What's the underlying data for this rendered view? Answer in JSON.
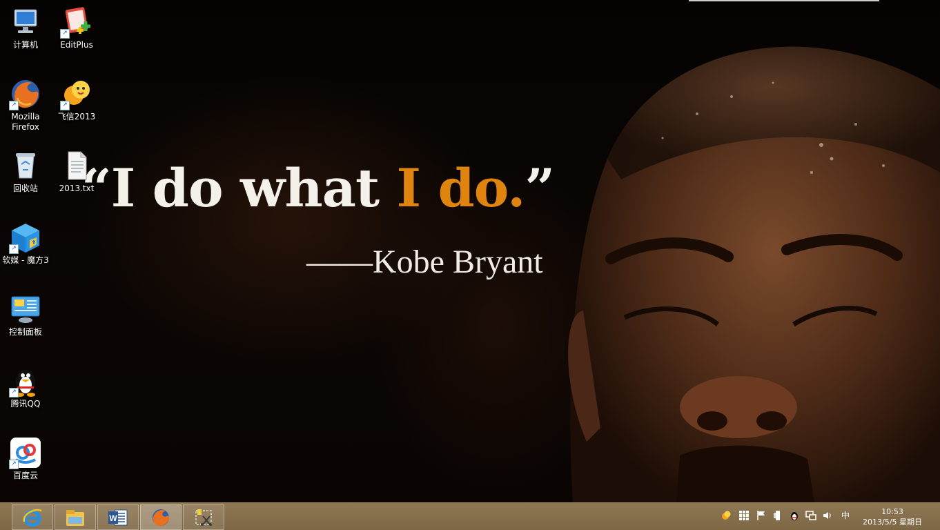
{
  "wallpaper": {
    "quote_open": "“",
    "quote_white": "I do what ",
    "quote_orange": "I do.",
    "quote_close": "”",
    "attribution": "——Kobe Bryant",
    "accent_color": "#e08410"
  },
  "desktop_icons": [
    {
      "label": "计算机",
      "icon": "computer-icon"
    },
    {
      "label": "EditPlus",
      "icon": "editplus-icon"
    },
    {
      "label": "Mozilla\nFirefox",
      "icon": "firefox-icon"
    },
    {
      "label": "飞信2013",
      "icon": "fetion-icon"
    },
    {
      "label": "回收站",
      "icon": "recycle-bin-icon"
    },
    {
      "label": "2013.txt",
      "icon": "text-file-icon"
    },
    {
      "label": "软媒 - 魔方3",
      "icon": "rubik-cube-icon"
    },
    {
      "label": "控制面板",
      "icon": "control-panel-icon"
    },
    {
      "label": "腾讯QQ",
      "icon": "qq-penguin-icon"
    },
    {
      "label": "百度云",
      "icon": "baidu-cloud-icon"
    }
  ],
  "taskbar": {
    "buttons": [
      {
        "icon": "internet-explorer-icon"
      },
      {
        "icon": "file-explorer-icon"
      },
      {
        "icon": "word-icon"
      },
      {
        "icon": "firefox-icon",
        "active": true
      },
      {
        "icon": "snipping-tool-icon"
      }
    ],
    "tray": {
      "input_method": "中",
      "icons": [
        "fetion-tray-icon",
        "grid-icon",
        "flag-icon",
        "usb-icon",
        "qq-tray-icon",
        "network-icon",
        "volume-icon"
      ]
    },
    "clock": {
      "time": "10:53",
      "date": "2013/5/5 星期日"
    }
  }
}
